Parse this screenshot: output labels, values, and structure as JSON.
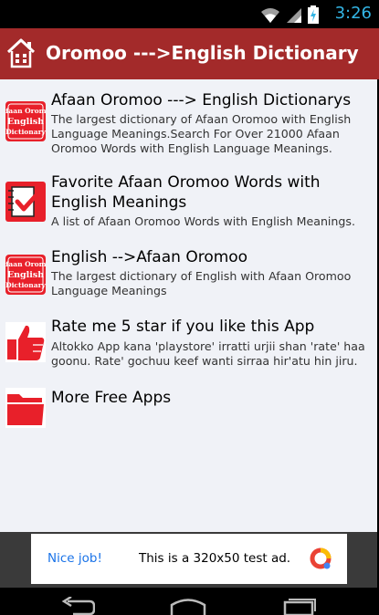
{
  "status": {
    "time": "3:26"
  },
  "appbar": {
    "title": "Oromoo --->English Dictionary"
  },
  "items": [
    {
      "title": "Afaan Oromoo ---> English Dictionarys",
      "description": "The largest dictionary of Afaan Oromoo with English Language Meanings.Search For Over 21000 Afaan Oromoo Words with English Language Meanings.",
      "icon": "afaan-oromoo-english-dictionary-icon",
      "icon_text": [
        "Afaan Oromo",
        "English",
        "Dictionary"
      ]
    },
    {
      "title": "Favorite Afaan Oromoo Words with English Meanings",
      "description": "A list of Afaan Oromoo Words with English Meanings.",
      "icon": "checklist-icon"
    },
    {
      "title": "English -->Afaan Oromoo",
      "description": "The largest dictionary of English with Afaan Oromoo Language Meanings",
      "icon": "afaan-oromoo-english-dictionary-icon",
      "icon_text": [
        "Afaan Oromo",
        "English",
        "Dictionary"
      ]
    },
    {
      "title": "Rate me 5 star if you like this App",
      "description": "Altokko App kana 'playstore' irratti urjii shan 'rate' haa goonu. Rate' gochuu keef wanti sirraa hir'atu hin jiru.",
      "icon": "thumbs-up-icon"
    },
    {
      "title": "More Free Apps",
      "description": "",
      "icon": "folder-icon"
    }
  ],
  "ad": {
    "label": "Nice job!",
    "text": "This is a 320x50 test ad."
  },
  "colors": {
    "appbar": "#a32a2a",
    "content_bg": "#f0f2f7",
    "icon_red": "#e8202a",
    "ad_label": "#1a73e8",
    "status_time": "#33b5e5"
  }
}
